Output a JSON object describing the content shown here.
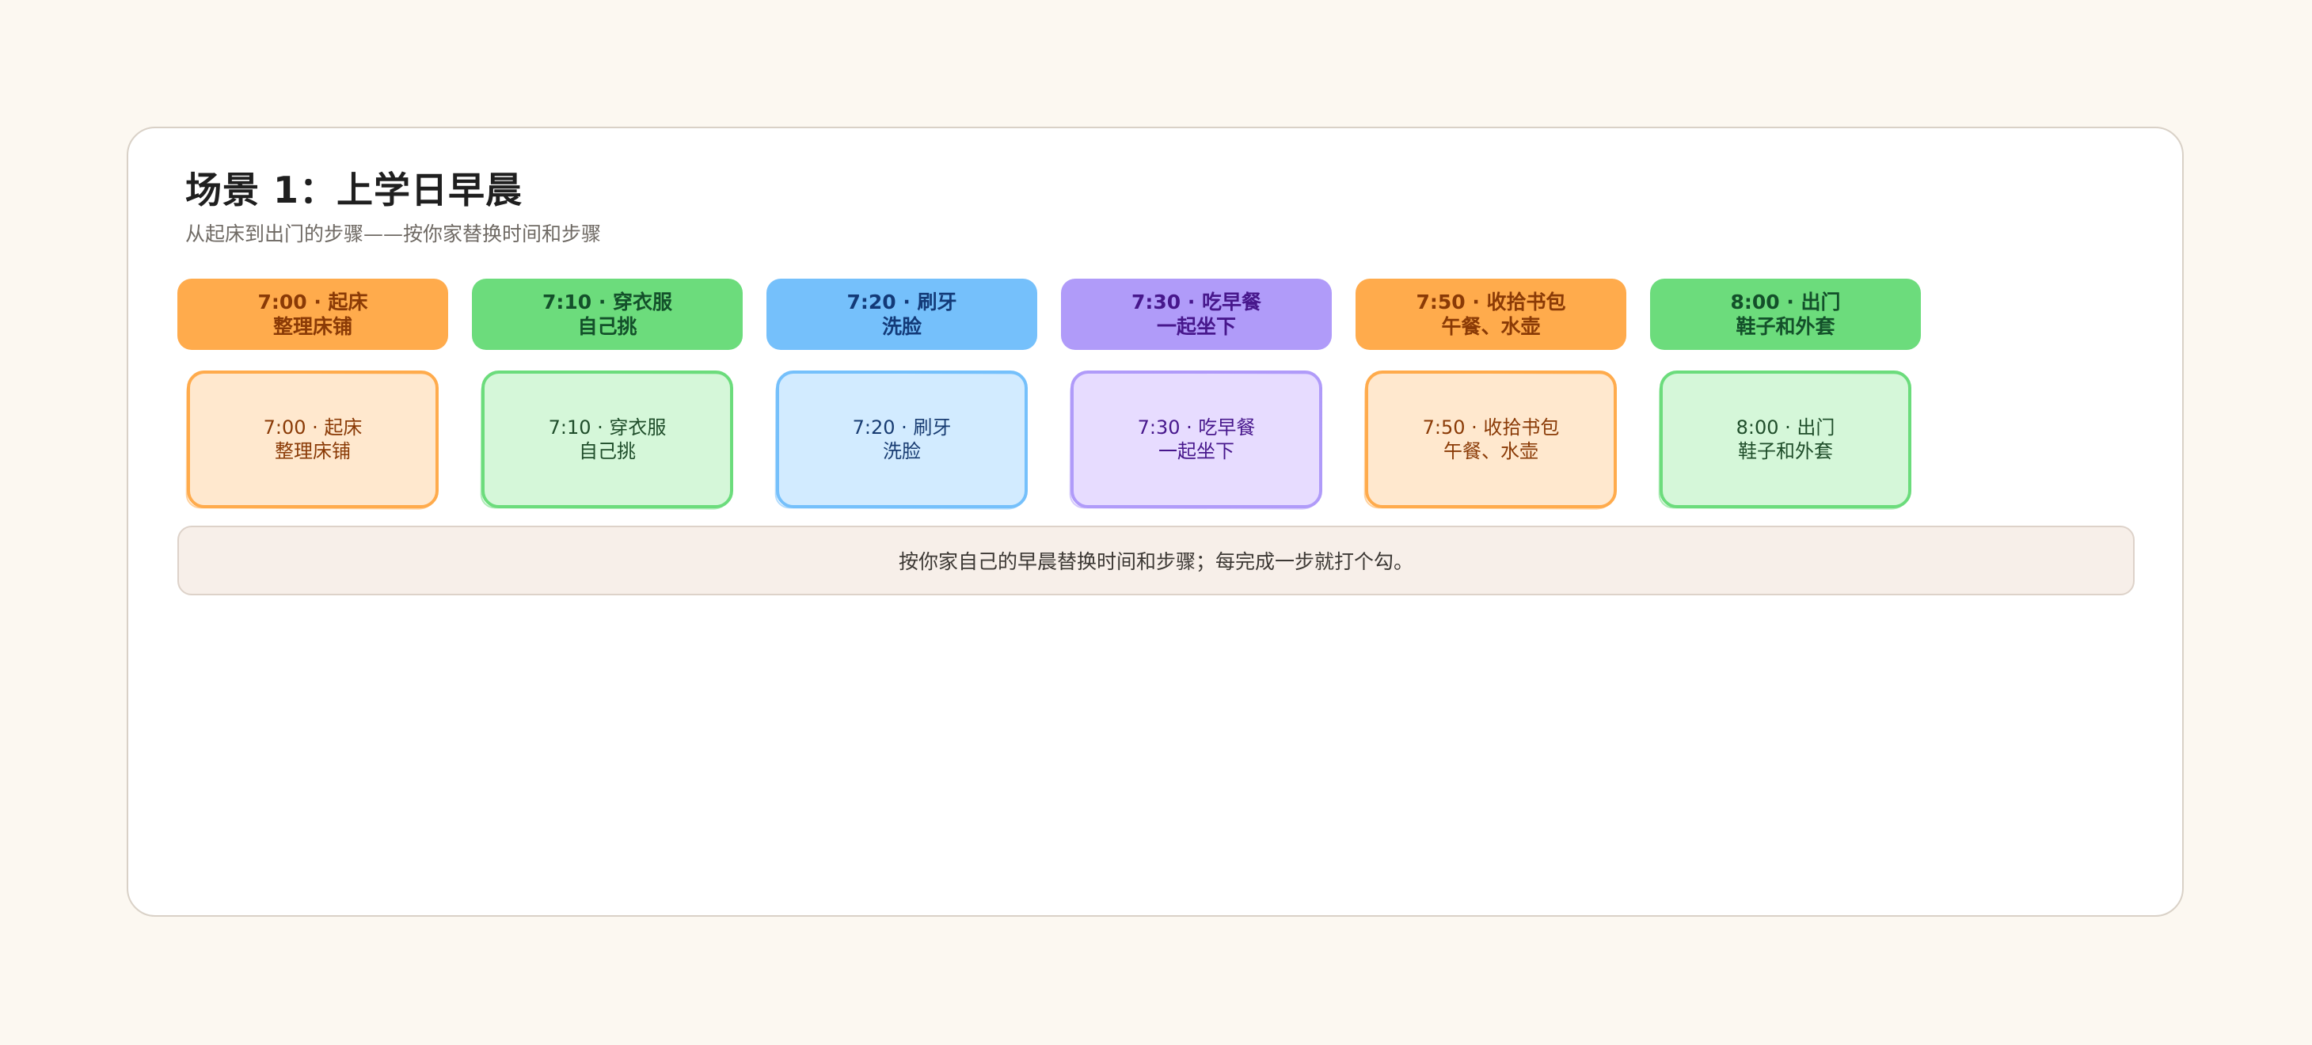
{
  "page": {
    "title": "场景 1：上学日早晨",
    "subtitle": "从起床到出门的步骤——按你家替换时间和步骤",
    "footer": "按你家自己的早晨替换时间和步骤；每完成一步就打个勾。"
  },
  "steps": [
    {
      "line1": "7:00 · 起床",
      "line2": "整理床铺",
      "colors": {
        "pill_bg": "#ffab4c",
        "pill_text": "#8a3a06",
        "note_bg": "#ffe8ce",
        "note_border": "#ffab4c",
        "note_text": "#8a3a06"
      }
    },
    {
      "line1": "7:10 · 穿衣服",
      "line2": "自己挑",
      "colors": {
        "pill_bg": "#6cdc7c",
        "pill_text": "#13502a",
        "note_bg": "#d5f7d9",
        "note_border": "#6cdc7c",
        "note_text": "#1f4d2a"
      }
    },
    {
      "line1": "7:20 · 刷牙",
      "line2": "洗脸",
      "colors": {
        "pill_bg": "#75c0fb",
        "pill_text": "#133a78",
        "note_bg": "#d2ebff",
        "note_border": "#75c0fb",
        "note_text": "#183c72"
      }
    },
    {
      "line1": "7:30 · 吃早餐",
      "line2": "一起坐下",
      "colors": {
        "pill_bg": "#b09bf9",
        "pill_text": "#47178c",
        "note_bg": "#e7dcff",
        "note_border": "#b09bf9",
        "note_text": "#47178c"
      }
    },
    {
      "line1": "7:50 · 收拾书包",
      "line2": "午餐、水壶",
      "colors": {
        "pill_bg": "#ffab4c",
        "pill_text": "#8a3a06",
        "note_bg": "#ffe8ce",
        "note_border": "#ffab4c",
        "note_text": "#8a3a06"
      }
    },
    {
      "line1": "8:00 · 出门",
      "line2": "鞋子和外套",
      "colors": {
        "pill_bg": "#6cdc7c",
        "pill_text": "#13502a",
        "note_bg": "#d5f7d9",
        "note_border": "#6cdc7c",
        "note_text": "#1f4d2a"
      }
    }
  ]
}
